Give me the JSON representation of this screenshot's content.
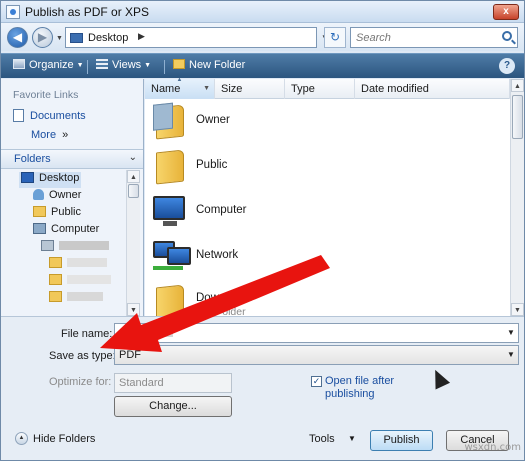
{
  "window": {
    "title": "Publish as PDF or XPS",
    "close_label": "x"
  },
  "address": {
    "location": "Desktop",
    "search_placeholder": "Search"
  },
  "toolbar": {
    "organize": "Organize",
    "views": "Views",
    "new_folder": "New Folder",
    "help": "?"
  },
  "nav": {
    "favorite_links_title": "Favorite Links",
    "favorites": [
      "Documents",
      "More"
    ],
    "more_suffix": "»",
    "folders_label": "Folders",
    "tree": [
      "Desktop",
      "Owner",
      "Public",
      "Computer"
    ]
  },
  "columns": [
    "Name",
    "Size",
    "Type",
    "Date modified"
  ],
  "files": [
    {
      "name": "Owner",
      "sub": ""
    },
    {
      "name": "Public",
      "sub": ""
    },
    {
      "name": "Computer",
      "sub": ""
    },
    {
      "name": "Network",
      "sub": ""
    },
    {
      "name": "Downloads",
      "sub": "File Folder"
    }
  ],
  "form": {
    "file_name_label": "File name:",
    "file_name_value": "",
    "save_type_label": "Save as type:",
    "save_type_value": "PDF",
    "optimize_label": "Optimize for:",
    "optimize_value": "Standard",
    "change_button": "Change...",
    "open_after_label": "Open file after publishing",
    "open_after_checked": true
  },
  "footer": {
    "hide_folders": "Hide Folders",
    "tools": "Tools",
    "publish": "Publish",
    "cancel": "Cancel"
  },
  "annotation": {
    "arrow_color": "#e8140f"
  },
  "watermark": "wsxdn.com"
}
